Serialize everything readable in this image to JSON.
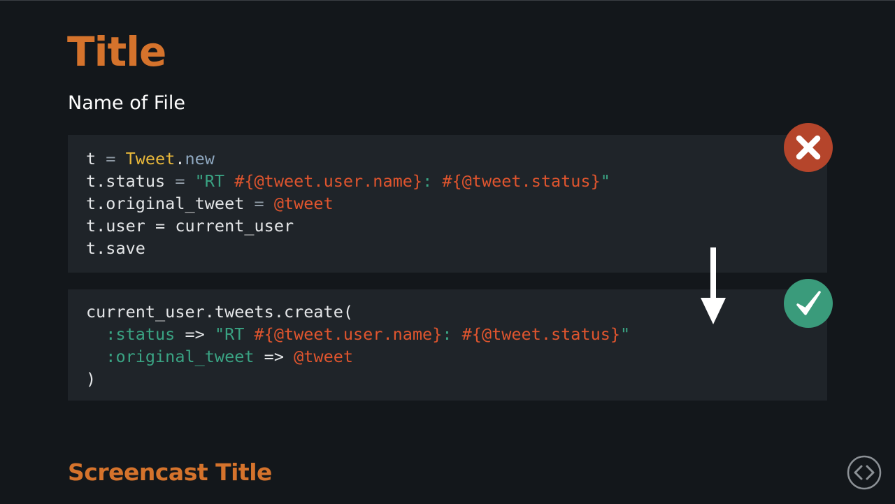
{
  "slide": {
    "title": "Title",
    "file_name": "Name of File",
    "screencast_title": "Screencast Title"
  },
  "badges": {
    "bad_icon": "x-icon",
    "good_icon": "check-icon",
    "bad_color": "#b5452b",
    "good_color": "#3a9b7b"
  },
  "code_bad": {
    "line1": {
      "var": "t",
      "assign": " = ",
      "const": "Tweet",
      "dot": ".",
      "method": "new"
    },
    "line2": {
      "prefix": "t.status",
      "assign": " = ",
      "q1": "\"RT ",
      "i1": "#{",
      "iv1": "@tweet",
      "m1": ".user.name",
      "i2": "}",
      "mid": ": ",
      "i3": "#{",
      "iv2": "@tweet",
      "m2": ".status",
      "i4": "}",
      "q2": "\""
    },
    "line3": {
      "prefix": "t.original_tweet",
      "assign": " = ",
      "ivar": "@tweet"
    },
    "line4": {
      "text": "t.user = current_user"
    },
    "line5": {
      "text": "t.save"
    }
  },
  "code_good": {
    "line1": {
      "text": "current_user.tweets.create("
    },
    "line2": {
      "indent": "  ",
      "sym": ":status",
      "arrow": " => ",
      "q1": "\"RT ",
      "i1": "#{",
      "iv1": "@tweet",
      "m1": ".user.name",
      "i2": "}",
      "mid": ": ",
      "i3": "#{",
      "iv2": "@tweet",
      "m2": ".status",
      "i4": "}",
      "q2": "\""
    },
    "line3": {
      "indent": "  ",
      "sym": ":original_tweet",
      "arrow": " => ",
      "ivar": "@tweet"
    },
    "line4": {
      "text": ")"
    }
  },
  "icons": {
    "arrow": "arrow-down-icon",
    "logo": "code-brackets-logo-icon"
  },
  "colors": {
    "accent": "#d5732c",
    "background": "#13171b",
    "code_background": "#1f2429"
  }
}
